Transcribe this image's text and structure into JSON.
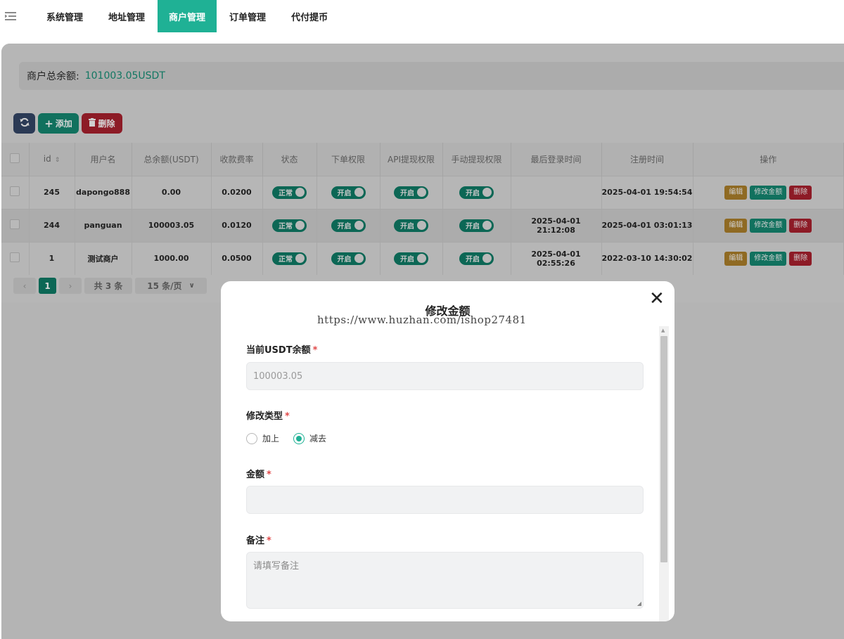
{
  "nav": {
    "items": [
      {
        "label": "系统管理"
      },
      {
        "label": "地址管理"
      },
      {
        "label": "商户管理",
        "active": true
      },
      {
        "label": "订单管理"
      },
      {
        "label": "代付提币"
      }
    ]
  },
  "summary": {
    "label": "商户总余额:",
    "value": "101003.05USDT"
  },
  "toolbar": {
    "add_label": "添加",
    "delete_label": "删除"
  },
  "table": {
    "headers": [
      "id",
      "用户名",
      "总余额(USDT)",
      "收款费率",
      "状态",
      "下单权限",
      "API提现权限",
      "手动提现权限",
      "最后登录时间",
      "注册时间",
      "操作"
    ],
    "rows": [
      {
        "id": "245",
        "username": "dapongo888",
        "balance": "0.00",
        "rate": "0.0200",
        "status": "正常",
        "order_perm": "开启",
        "api_perm": "开启",
        "manual_perm": "开启",
        "last_login": "",
        "registered": "2025-04-01 19:54:54"
      },
      {
        "id": "244",
        "username": "panguan",
        "balance": "100003.05",
        "rate": "0.0120",
        "status": "正常",
        "order_perm": "开启",
        "api_perm": "开启",
        "manual_perm": "开启",
        "last_login": "2025-04-01 21:12:08",
        "registered": "2025-04-01 03:01:13"
      },
      {
        "id": "1",
        "username": "测试商户",
        "balance": "1000.00",
        "rate": "0.0500",
        "status": "正常",
        "order_perm": "开启",
        "api_perm": "开启",
        "manual_perm": "开启",
        "last_login": "2025-04-01 02:55:26",
        "registered": "2022-03-10 14:30:02"
      }
    ],
    "actions": {
      "edit": "编辑",
      "amount": "修改金额",
      "delete": "删除"
    }
  },
  "pager": {
    "current": "1",
    "total": "共 3 条",
    "page_size": "15 条/页"
  },
  "modal": {
    "title": "修改金额",
    "watermark": "https://www.huzhan.com/ishop27481",
    "current_label": "当前USDT余额",
    "current_value": "100003.05",
    "type_label": "修改类型",
    "type_options": [
      {
        "label": "加上",
        "selected": false
      },
      {
        "label": "减去",
        "selected": true
      }
    ],
    "amount_label": "金额",
    "amount_value": "",
    "remark_label": "备注",
    "remark_placeholder": "请填写备注",
    "required_mark": "*"
  },
  "colors": {
    "brand": "#1fb195",
    "danger": "#e04848",
    "warning": "#f0a43a"
  }
}
